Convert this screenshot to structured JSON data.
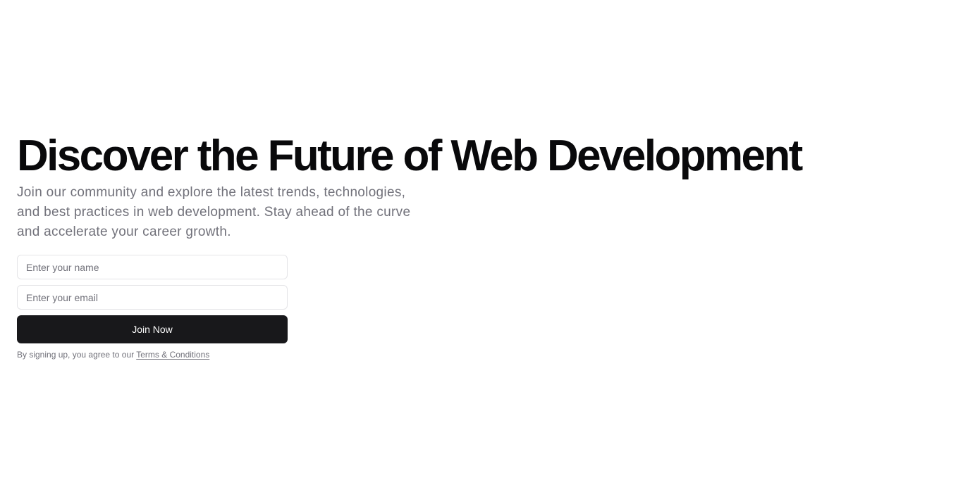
{
  "hero": {
    "title": "Discover the Future of Web Development",
    "subtitle": "Join our community and explore the latest trends, technologies, and best practices in web development. Stay ahead of the curve and accelerate your career growth."
  },
  "form": {
    "name_placeholder": "Enter your name",
    "email_placeholder": "Enter your email",
    "submit_label": "Join Now"
  },
  "legal": {
    "prefix": "By signing up, you agree to our ",
    "link_label": "Terms & Conditions"
  },
  "colors": {
    "text_primary": "#09090b",
    "text_muted": "#71717a",
    "button_bg": "#18181b",
    "button_text": "#fafafa",
    "border": "#e4e4e7",
    "background": "#ffffff"
  }
}
